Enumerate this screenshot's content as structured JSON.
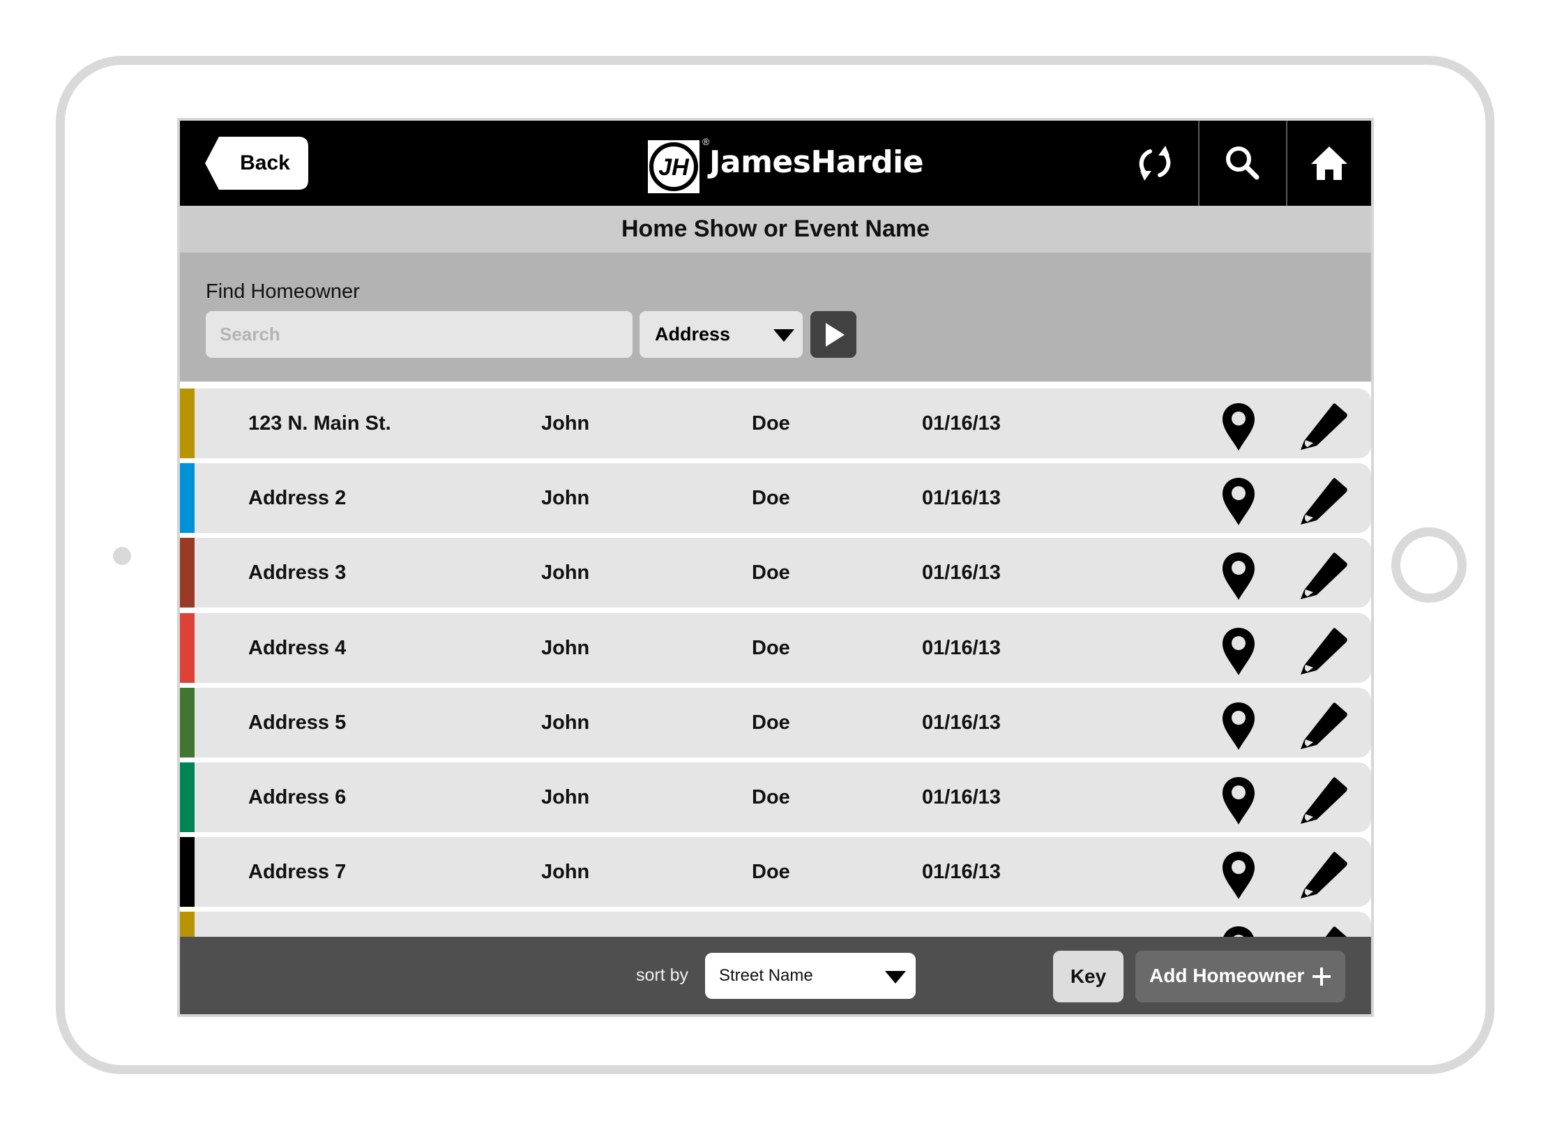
{
  "header": {
    "back_label": "Back",
    "brand_name": "JamesHardie",
    "brand_mark": "JH",
    "registered_mark": "®",
    "icons": [
      "refresh-icon",
      "search-icon",
      "home-icon"
    ]
  },
  "title": "Home Show or Event Name",
  "search": {
    "label": "Find Homeowner",
    "placeholder": "Search",
    "value": "",
    "field_selected": "Address",
    "go_icon": "play-icon"
  },
  "rows": [
    {
      "address": "123 N. Main St.",
      "first": "John",
      "last": "Doe",
      "date": "01/16/13",
      "color": "#b89400"
    },
    {
      "address": "Address 2",
      "first": "John",
      "last": "Doe",
      "date": "01/16/13",
      "color": "#0092d8"
    },
    {
      "address": "Address 3",
      "first": "John",
      "last": "Doe",
      "date": "01/16/13",
      "color": "#983a26"
    },
    {
      "address": "Address 4",
      "first": "John",
      "last": "Doe",
      "date": "01/16/13",
      "color": "#dd4236"
    },
    {
      "address": "Address 5",
      "first": "John",
      "last": "Doe",
      "date": "01/16/13",
      "color": "#437532"
    },
    {
      "address": "Address 6",
      "first": "John",
      "last": "Doe",
      "date": "01/16/13",
      "color": "#008456"
    },
    {
      "address": "Address 7",
      "first": "John",
      "last": "Doe",
      "date": "01/16/13",
      "color": "#000000"
    },
    {
      "address": "",
      "first": "",
      "last": "",
      "date": "",
      "color": "#b89400"
    }
  ],
  "row_icons": [
    "map-pin-icon",
    "pencil-icon"
  ],
  "footer": {
    "sort_label": "sort by",
    "sort_selected": "Street Name",
    "key_label": "Key",
    "add_label": "Add Homeowner"
  },
  "colors": {
    "header_bg": "#000000",
    "titlebar_bg": "#cccccc",
    "search_panel_bg": "#b3b3b3",
    "row_bg": "#e5e5e5",
    "footer_bg": "#4f4f4f",
    "add_button_bg": "#6a6a6a",
    "go_button_bg": "#414141"
  }
}
